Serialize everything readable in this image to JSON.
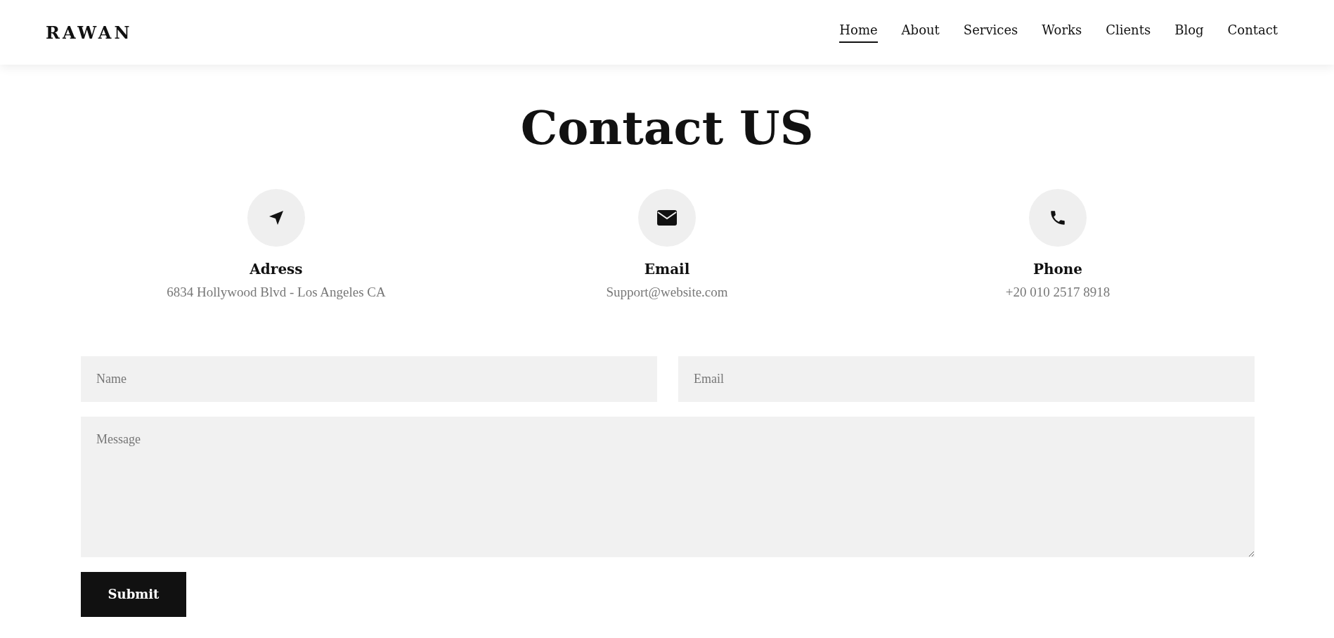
{
  "header": {
    "logo": "RAWAN",
    "nav": [
      {
        "label": "Home",
        "selected": true
      },
      {
        "label": "About",
        "selected": false
      },
      {
        "label": "Services",
        "selected": false
      },
      {
        "label": "Works",
        "selected": false
      },
      {
        "label": "Clients",
        "selected": false
      },
      {
        "label": "Blog",
        "selected": false
      },
      {
        "label": "Contact",
        "selected": false
      }
    ]
  },
  "title": "Contact US",
  "info": [
    {
      "kind": "location",
      "label": "Adress",
      "value": "6834 Hollywood Blvd - Los Angeles CA"
    },
    {
      "kind": "email",
      "label": "Email",
      "value": "Support@website.com"
    },
    {
      "kind": "phone",
      "label": "Phone",
      "value": "+20 010 2517 8918"
    }
  ],
  "form": {
    "name": {
      "placeholder": "Name"
    },
    "email": {
      "placeholder": "Email"
    },
    "message": {
      "placeholder": "Message"
    },
    "submit": "Submit"
  }
}
